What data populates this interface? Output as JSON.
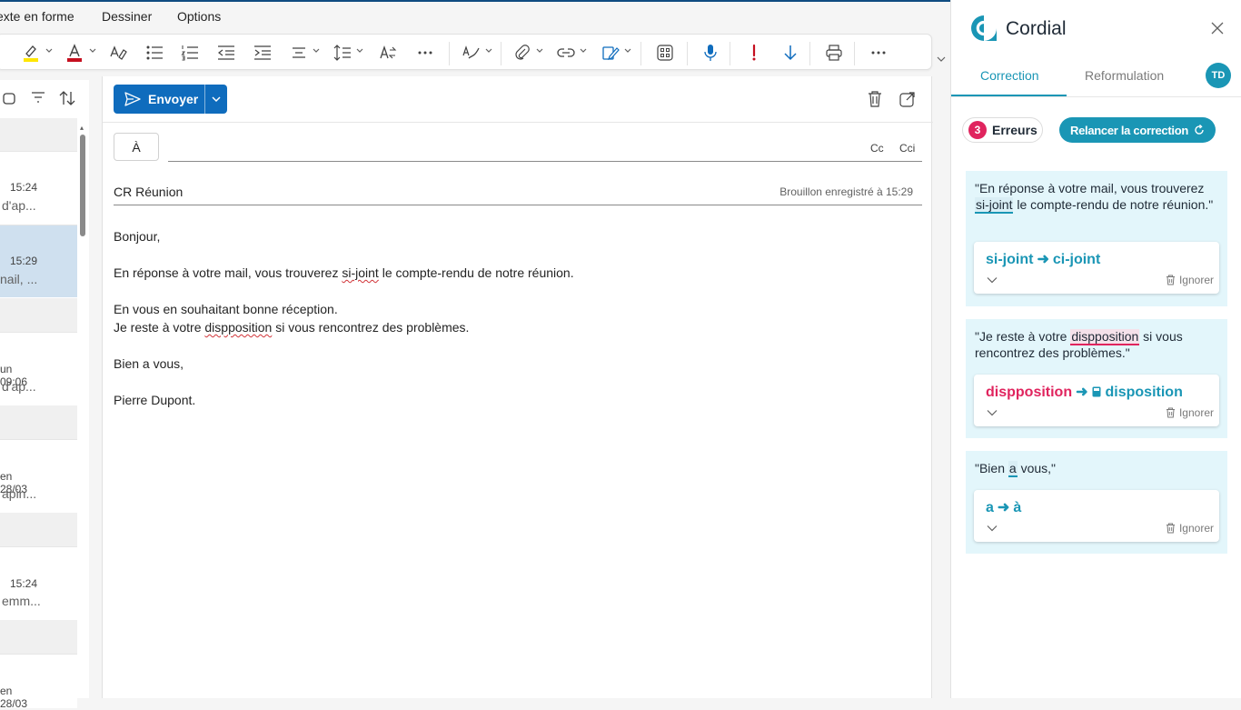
{
  "menubar": {
    "items": [
      "exte en forme",
      "Dessiner",
      "Options"
    ]
  },
  "ribbon": {
    "tools": [
      "highlight-icon",
      "font-color-icon",
      "clear-format-icon",
      "bullets-icon",
      "numbering-icon",
      "outdent-icon",
      "indent-icon",
      "align-icon",
      "line-spacing-icon",
      "styles-icon",
      "more-icon",
      "editor-icon",
      "attach-icon",
      "link-icon",
      "signature-icon",
      "apps-icon",
      "dictate-icon",
      "importance-icon",
      "low-importance-icon",
      "print-icon",
      "overflow-icon"
    ]
  },
  "message_list": {
    "items": [
      {
        "time": "15:24",
        "preview": "d'ap..."
      },
      {
        "time": "15:29",
        "preview": "nail, ..."
      },
      {
        "time": "un 09:06",
        "preview": "d'ap..."
      },
      {
        "time": "en 28/03",
        "preview": "apin..."
      },
      {
        "time": "15:24",
        "preview": "emm..."
      },
      {
        "time": "en 28/03",
        "preview": ""
      }
    ]
  },
  "compose": {
    "send_label": "Envoyer",
    "to_label": "À",
    "cc_label": "Cc",
    "bcc_label": "Cci",
    "subject": "CR Réunion",
    "saved_status": "Brouillon enregistré à 15:29",
    "body": {
      "greeting": "Bonjour,",
      "line1_pre": "En réponse à votre mail, vous trouverez ",
      "line1_err": "si-joint",
      "line1_post": " le compte-rendu de notre réunion.",
      "line2": "En vous en souhaitant bonne réception.",
      "line3_pre": "Je reste à votre ",
      "line3_err": "dispposition",
      "line3_post": " si vous rencontrez des problèmes.",
      "closing": "Bien a vous,",
      "signature": "Pierre Dupont."
    }
  },
  "panel": {
    "brand": "Cordial",
    "tab_correction": "Correction",
    "tab_reformulation": "Reformulation",
    "avatar_initials": "TD",
    "error_count": "3",
    "error_label": "Erreurs",
    "rerun_label": "Relancer la correction",
    "ignore_label": "Ignorer",
    "cards": [
      {
        "ctx_pre": "\"En réponse à votre mail, vous trouverez ",
        "ctx_err": "si-joint",
        "ctx_post": " le compte-rendu de notre réunion.\"",
        "from": "si-joint",
        "arrow": "➜",
        "to": "ci-joint"
      },
      {
        "ctx_pre": "\"Je reste à votre ",
        "ctx_err": "dispposition",
        "ctx_post": " si vous rencontrez des problèmes.\"",
        "from": "dispposition",
        "arrow": "➜",
        "to": "disposition"
      },
      {
        "ctx_pre": "\"Bien ",
        "ctx_err": "a",
        "ctx_post": " vous,\"",
        "from": "a",
        "arrow": "➜",
        "to": "à"
      }
    ]
  },
  "colors": {
    "accent": "#1a96b5",
    "error": "#e0245e",
    "send": "#0f6cbd",
    "selected_row": "#cfe0ef",
    "card_bg": "#e3f6fb"
  }
}
